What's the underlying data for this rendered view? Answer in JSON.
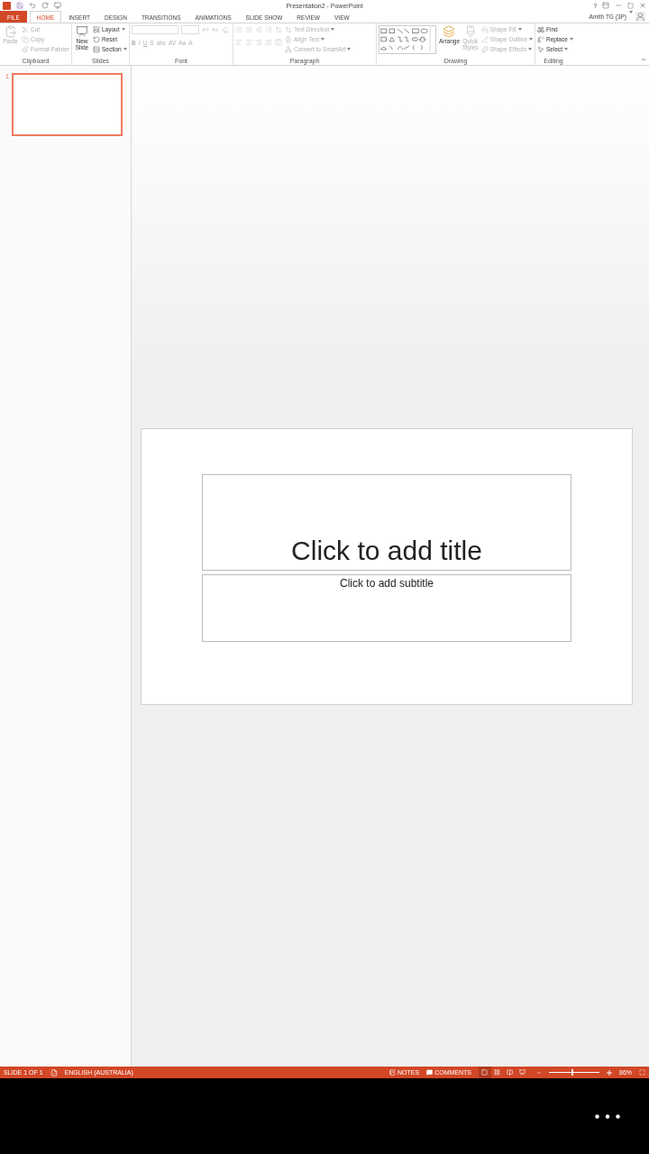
{
  "window": {
    "title": "Presentation2 - PowerPoint",
    "help": "?"
  },
  "tabs": [
    {
      "label": "FILE",
      "kind": "file",
      "selected": false
    },
    {
      "label": "HOME",
      "kind": "tab",
      "selected": true
    },
    {
      "label": "INSERT",
      "kind": "tab",
      "selected": false
    },
    {
      "label": "DESIGN",
      "kind": "tab",
      "selected": false
    },
    {
      "label": "TRANSITIONS",
      "kind": "tab",
      "selected": false
    },
    {
      "label": "ANIMATIONS",
      "kind": "tab",
      "selected": false
    },
    {
      "label": "SLIDE SHOW",
      "kind": "tab",
      "selected": false
    },
    {
      "label": "REVIEW",
      "kind": "tab",
      "selected": false
    },
    {
      "label": "VIEW",
      "kind": "tab",
      "selected": false
    }
  ],
  "user": {
    "name": "Amith TG (3P)"
  },
  "ribbon": {
    "clipboard": {
      "label": "Clipboard",
      "paste": {
        "label": "Paste",
        "disabled": true
      },
      "items": [
        {
          "label": "Cut",
          "disabled": true
        },
        {
          "label": "Copy",
          "disabled": true
        },
        {
          "label": "Format Painter",
          "disabled": true
        }
      ]
    },
    "slides": {
      "label": "Slides",
      "new_slide": {
        "label": "New Slide",
        "disabled": false
      },
      "items": [
        {
          "label": "Layout",
          "disabled": false
        },
        {
          "label": "Reset",
          "disabled": false
        },
        {
          "label": "Section",
          "disabled": false
        }
      ]
    },
    "font": {
      "label": "Font",
      "buttons": [
        {
          "label": "B",
          "disabled": true
        },
        {
          "label": "I",
          "disabled": true
        },
        {
          "label": "U",
          "disabled": true
        },
        {
          "label": "S",
          "disabled": true
        },
        {
          "label": "abc",
          "disabled": true
        },
        {
          "label": "AV",
          "disabled": true
        },
        {
          "label": "Aa",
          "disabled": true
        },
        {
          "label": "A",
          "disabled": true
        }
      ]
    },
    "paragraph": {
      "label": "Paragraph",
      "items": [
        {
          "label": "Text Direction",
          "disabled": true
        },
        {
          "label": "Align Text",
          "disabled": true
        },
        {
          "label": "Convert to SmartArt",
          "disabled": true
        }
      ]
    },
    "drawing": {
      "label": "Drawing",
      "arrange": {
        "label": "Arrange",
        "disabled": false
      },
      "quick_styles": {
        "label": "Quick Styles",
        "disabled": true
      },
      "items": [
        {
          "label": "Shape Fill",
          "disabled": true
        },
        {
          "label": "Shape Outline",
          "disabled": true
        },
        {
          "label": "Shape Effects",
          "disabled": true
        }
      ]
    },
    "editing": {
      "label": "Editing",
      "items": [
        {
          "label": "Find",
          "disabled": false
        },
        {
          "label": "Replace",
          "disabled": false
        },
        {
          "label": "Select",
          "disabled": false
        }
      ]
    }
  },
  "thumbnails": [
    {
      "number": "1",
      "selected": true
    }
  ],
  "slide": {
    "title_placeholder": "Click to add title",
    "subtitle_placeholder": "Click to add subtitle"
  },
  "status_bar": {
    "slide": "SLIDE 1 OF 1",
    "language": "ENGLISH (AUSTRALIA)",
    "notes": "NOTES",
    "comments": "COMMENTS",
    "zoom": {
      "level": 0.45,
      "reading": "86%"
    }
  }
}
